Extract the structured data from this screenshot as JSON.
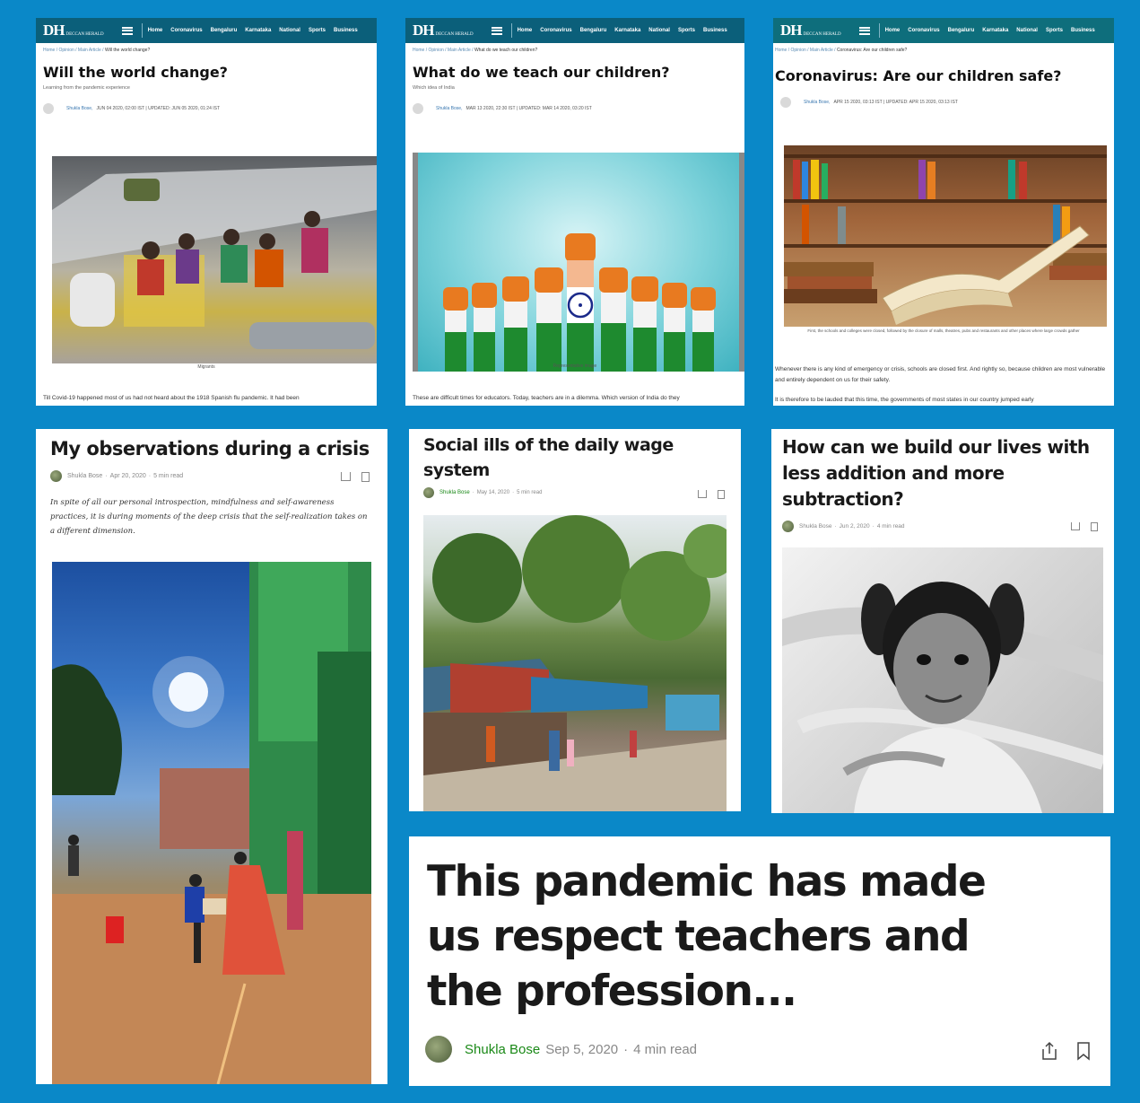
{
  "dh": {
    "logo": "DH",
    "logo_small": "DECCAN HERALD",
    "nav": [
      "Home",
      "Coronavirus",
      "Bengaluru",
      "Karnataka",
      "National",
      "Sports",
      "Business"
    ]
  },
  "card1": {
    "crumb_home": "Home",
    "crumb_opinion": "Opinion",
    "crumb_main": "Main Article",
    "crumb_current": "Will the world change?",
    "title": "Will the world change?",
    "subtitle": "Learning from the pandemic experience",
    "author": "Shukla Bose,",
    "dates": "JUN 04 2020, 02:00 IST | UPDATED: JUN 05 2020, 01:24 IST",
    "caption": "Migrants",
    "body": "Till Covid-19 happened most of us had not heard about the 1918 Spanish flu pandemic. It had been"
  },
  "card2": {
    "crumb_home": "Home",
    "crumb_opinion": "Opinion",
    "crumb_main": "Main Article",
    "crumb_current": "What do we teach our children?",
    "title": "What do we teach our children?",
    "subtitle": "Which idea of India",
    "author": "Shukla Bose,",
    "dates": "MAR 13 2020, 22:30 IST | UPDATED: MAR 14 2020, 03:20 IST",
    "caption": "Representative image",
    "body": "These are difficult times for educators. Today, teachers are in a dilemma. Which version of India do they"
  },
  "card3": {
    "crumb_home": "Home",
    "crumb_opinion": "Opinion",
    "crumb_main": "Main Article",
    "crumb_current": "Coronavirus: Are our children safe?",
    "title": "Coronavirus: Are our children safe?",
    "author": "Shukla Bose,",
    "dates": "APR 15 2020, 03:13 IST | UPDATED: APR 15 2020, 03:13 IST",
    "caption": "First, the schools and colleges were closed, followed by the closure of malls, theatres, pubs and restaurants and other places where large crowds gather",
    "body1": "Whenever there is any kind of emergency or crisis, schools are closed first. And rightly so, because children are most vulnerable and entirely dependent on us for their safety.",
    "body2": "It is therefore to be lauded that this time, the governments of most states in our country jumped early"
  },
  "card4": {
    "title": "My observations during a crisis",
    "author": "Shukla Bose",
    "date": "Apr 20, 2020",
    "read": "5 min read",
    "excerpt": "In spite of all our personal introspection, mindfulness and self-awareness practices, it is during moments of the deep crisis that the self-realization takes on a different dimension."
  },
  "card5": {
    "title": "Social ills of the daily wage system",
    "author": "Shukla Bose",
    "date": "May 14, 2020",
    "read": "5 min read"
  },
  "card6": {
    "title": "How can we build our lives with less addition and more subtraction?",
    "author": "Shukla Bose",
    "date": "Jun 2, 2020",
    "read": "4 min read"
  },
  "card7": {
    "title": "This pandemic has made us respect teachers and the profession...",
    "author": "Shukla Bose",
    "date": "Sep 5, 2020",
    "read": "4 min read"
  },
  "sep": "·"
}
